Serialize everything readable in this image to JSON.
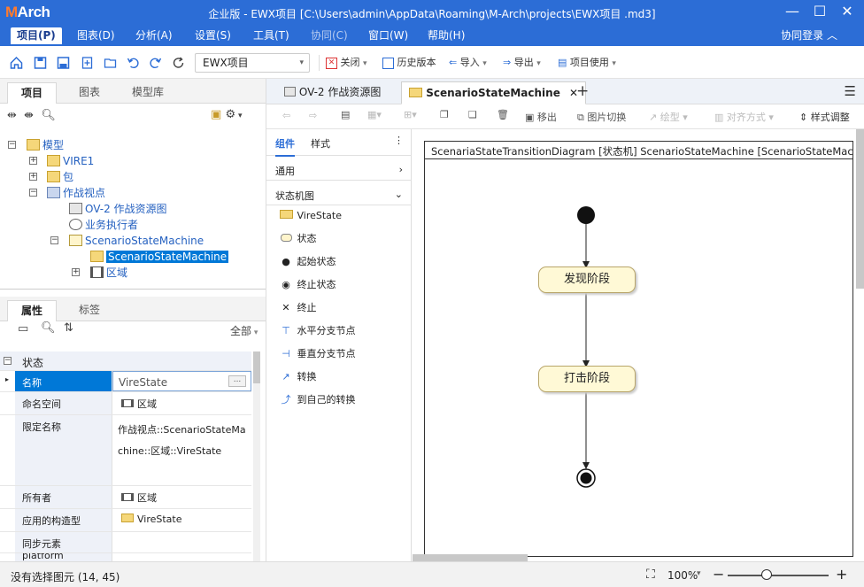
{
  "app": {
    "logo_m": "M",
    "logo_rest": "Arch",
    "title": "企业版 - EWX项目 [C:\\Users\\admin\\AppData\\Roaming\\M-Arch\\projects\\EWX项目 .md3]"
  },
  "menu": {
    "items": [
      "项目(P)",
      "图表(D)",
      "分析(A)",
      "设置(S)",
      "工具(T)",
      "协同(C)",
      "窗口(W)",
      "帮助(H)"
    ],
    "login": "协同登录"
  },
  "toolbar": {
    "project_combo": "EWX项目",
    "close": "关闭",
    "history": "历史版本",
    "import": "导入",
    "export": "导出",
    "project_use": "项目使用"
  },
  "left": {
    "tabs": [
      "项目",
      "图表",
      "模型库"
    ],
    "tree": [
      {
        "label": "模型"
      },
      {
        "label": "VIRE1"
      },
      {
        "label": "包"
      },
      {
        "label": "作战视点"
      },
      {
        "label": "OV-2 作战资源图"
      },
      {
        "label": "业务执行者"
      },
      {
        "label": "ScenarioStateMachine"
      },
      {
        "label": "ScenarioStateMachine"
      },
      {
        "label": "区域"
      }
    ],
    "prop_tabs": [
      "属性",
      "标签"
    ],
    "filter": "全部",
    "props": {
      "group": "状态",
      "rows": [
        {
          "k": "名称",
          "v": "VireState"
        },
        {
          "k": "命名空间",
          "v": "区域"
        },
        {
          "k": "限定名称",
          "v": "作战视点::ScenarioStateMachine::区域::VireState"
        },
        {
          "k": "所有者",
          "v": "区域"
        },
        {
          "k": "应用的构造型",
          "v": "VireState"
        },
        {
          "k": "同步元素",
          "v": ""
        },
        {
          "k": "platform",
          "v": ""
        }
      ],
      "ellipsis": "..."
    }
  },
  "editor": {
    "tabs": [
      "OV-2 作战资源图",
      "ScenarioStateMachine"
    ],
    "tools": {
      "move_out": "移出",
      "img_switch": "图片切换",
      "line": "绘型",
      "align": "对齐方式",
      "style_adjust": "样式调整"
    },
    "palette": {
      "tabs": [
        "组件",
        "样式"
      ],
      "sections": [
        "通用",
        "状态机图"
      ],
      "items": [
        "VireState",
        "状态",
        "起始状态",
        "终止状态",
        "终止",
        "水平分支节点",
        "垂直分支节点",
        "转换",
        "到自己的转换"
      ]
    },
    "frame_title": "ScenariaStateTransitionDiagram [状态机] ScenarioStateMachine [ScenarioStateMachine]",
    "states": [
      "发现阶段",
      "打击阶段"
    ]
  },
  "status": {
    "text": "没有选择图元 (14, 45)",
    "zoom": "100%"
  }
}
